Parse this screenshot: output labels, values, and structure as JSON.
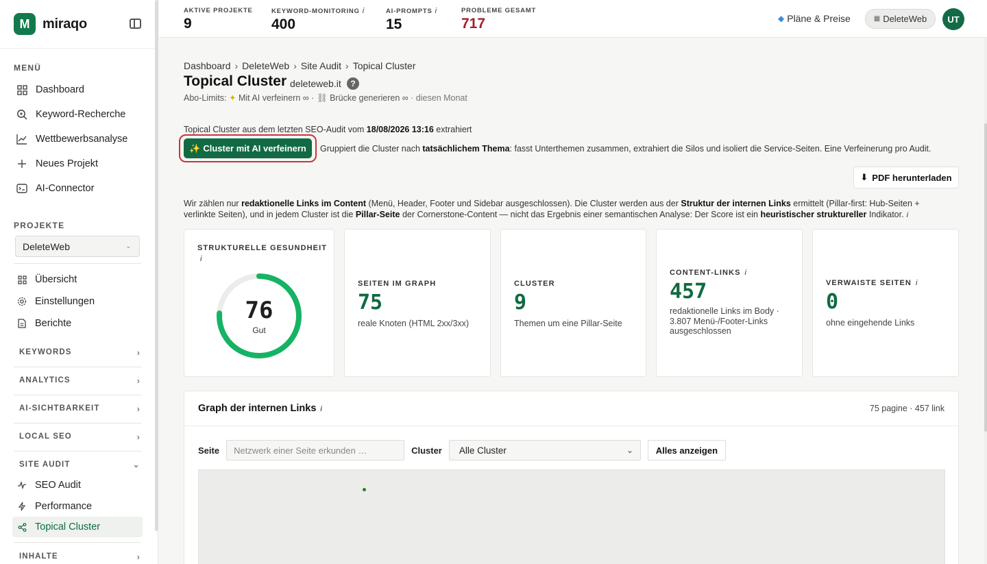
{
  "brand": {
    "logo_letter": "M",
    "name": "miraqo",
    "color": "#127a4c"
  },
  "sidebar": {
    "menu_label": "MENÜ",
    "menu": [
      {
        "label": "Dashboard",
        "icon": "grid-icon"
      },
      {
        "label": "Keyword-Recherche",
        "icon": "search-icon"
      },
      {
        "label": "Wettbewerbsanalyse",
        "icon": "chart-line-icon"
      },
      {
        "label": "Neues Projekt",
        "icon": "plus-icon"
      },
      {
        "label": "AI-Connector",
        "icon": "terminal-icon"
      }
    ],
    "projects_label": "PROJEKTE",
    "selected_project": "DeleteWeb",
    "project_menu": [
      {
        "label": "Übersicht",
        "icon": "grid-icon"
      },
      {
        "label": "Einstellungen",
        "icon": "gear-icon"
      },
      {
        "label": "Berichte",
        "icon": "document-icon"
      }
    ],
    "sections": [
      {
        "label": "KEYWORDS",
        "expanded": false
      },
      {
        "label": "ANALYTICS",
        "expanded": false
      },
      {
        "label": "AI-SICHTBARKEIT",
        "expanded": false
      },
      {
        "label": "LOCAL SEO",
        "expanded": false
      },
      {
        "label": "SITE AUDIT",
        "expanded": true
      },
      {
        "label": "INHALTE",
        "expanded": false
      }
    ],
    "site_audit_items": [
      {
        "label": "SEO Audit",
        "icon": "pulse-icon"
      },
      {
        "label": "Performance",
        "icon": "bolt-icon"
      },
      {
        "label": "Topical Cluster",
        "icon": "share-icon",
        "active": true
      }
    ]
  },
  "topbar": {
    "stats": [
      {
        "label": "AKTIVE PROJEKTE",
        "info": "",
        "value": "9"
      },
      {
        "label": "KEYWORD-MONITORING",
        "info": "i",
        "value": "400"
      },
      {
        "label": "AI-PROMPTS",
        "info": "i",
        "value": "15"
      },
      {
        "label": "PROBLEME GESAMT",
        "info": "",
        "value": "717"
      }
    ],
    "plans_link": "Pläne & Preise",
    "project_pill": "DeleteWeb",
    "avatar": "UT"
  },
  "breadcrumb": [
    "Dashboard",
    "DeleteWeb",
    "Site Audit",
    "Topical Cluster"
  ],
  "breadcrumb_sep": "›",
  "page": {
    "title": "Topical Cluster",
    "domain": "deleteweb.it",
    "help": "?",
    "limits_prefix": "Abo-Limits:",
    "limit_ai": "Mit AI verfeinern ∞",
    "limit_bridge": "Brücke generieren ∞",
    "limit_suffix": "· diesen Monat",
    "extract_prefix": "Topical Cluster aus dem letzten SEO-Audit vom",
    "extract_date": "18/08/2026 13:16",
    "extract_suffix": "extrahiert",
    "ai_button": "Cluster mit AI verfeinern",
    "ai_desc_1": "Gruppiert die Cluster nach",
    "ai_desc_bold": "tatsächlichem Thema",
    "ai_desc_2": ": fasst Unterthemen zusammen, extrahiert die Silos und isoliert die Service-Seiten. Eine Verfeinerung pro Audit.",
    "pdf_button": "PDF herunterladen",
    "note": {
      "t1": "Wir zählen nur",
      "b1": "redaktionelle Links im Content",
      "t2": "(Menü, Header, Footer und Sidebar ausgeschlossen). Die Cluster werden aus der",
      "b2": "Struktur der internen Links",
      "t3": "ermittelt (Pillar-first: Hub-Seiten + verlinkte Seiten), und in jedem Cluster ist die",
      "b3": "Pillar-Seite",
      "t4": "der Cornerstone-Content — nicht das Ergebnis einer semantischen Analyse: Der Score ist ein",
      "b4": "heuristischer struktureller",
      "t5": "Indikator.",
      "info": "i"
    }
  },
  "cards": {
    "health": {
      "label": "STRUKTURELLE GESUNDHEIT",
      "info": "i",
      "value": "76",
      "fraction": 0.76,
      "status": "Gut"
    },
    "pages": {
      "label": "SEITEN IM GRAPH",
      "value": "75",
      "sub": "reale Knoten (HTML 2xx/3xx)"
    },
    "clusters": {
      "label": "CLUSTER",
      "value": "9",
      "sub": "Themen um eine Pillar-Seite"
    },
    "links": {
      "label": "CONTENT-LINKS",
      "info": "i",
      "value": "457",
      "sub": "redaktionelle Links im Body · 3.807 Menü-/Footer-Links ausgeschlossen"
    },
    "orphans": {
      "label": "VERWAISTE SEITEN",
      "info": "i",
      "value": "0",
      "sub": "ohne eingehende Links"
    }
  },
  "graph": {
    "title": "Graph der internen Links",
    "info": "i",
    "meta": "75 pagine · 457 link",
    "page_label": "Seite",
    "search_placeholder": "Netzwerk einer Seite erkunden …",
    "cluster_label": "Cluster",
    "cluster_value": "Alle Cluster",
    "show_all": "Alles anzeigen"
  },
  "colors": {
    "accent": "#116a43",
    "danger": "#a3202a",
    "gauge": "#16b364"
  }
}
